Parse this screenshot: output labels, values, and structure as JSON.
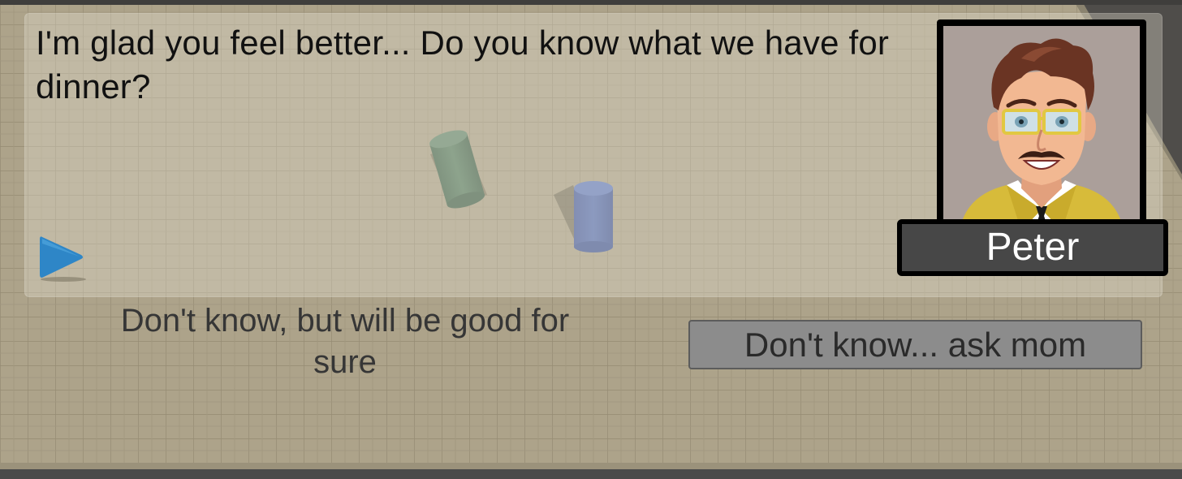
{
  "dialogue": {
    "text": "I'm glad you feel better... Do you know what we have for dinner?",
    "continue_icon": "play-triangle-icon"
  },
  "speaker": {
    "name": "Peter",
    "portrait": "man-with-glasses-portrait"
  },
  "choices": [
    {
      "label": "Don't know, but will be good for sure"
    },
    {
      "label": "Don't know... ask mom"
    }
  ],
  "colors": {
    "floor": "#aca289",
    "panel": "#d8d3c2",
    "continue_icon": "#2e86c7",
    "name_plate": "#474747",
    "choice_button": "#8c8c8c",
    "cylinder_green": "#5e8066",
    "cylinder_blue": "#5a6fae"
  }
}
